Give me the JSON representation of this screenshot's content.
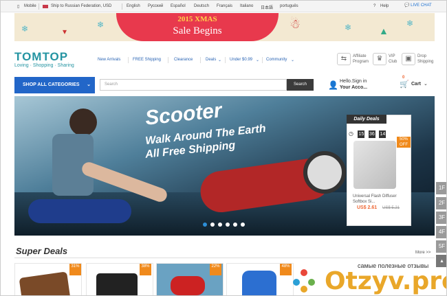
{
  "topbar": {
    "mobile": "Mobile",
    "ship_to": "Ship to Russian Federation, USD",
    "languages": [
      "English",
      "Русский",
      "Español",
      "Deutsch",
      "Français",
      "Italiano",
      "日本語",
      "português"
    ],
    "help": "Help",
    "live_chat": "LIVE CHAT"
  },
  "banner": {
    "line1": "2015 XMAS",
    "line2": "Sale Begins"
  },
  "header": {
    "logo": "TOMTOP",
    "tagline": "Loving · Shopping · Sharing",
    "nav": [
      "New Arrivals",
      "FREE Shipping",
      "Clearance",
      "Deals",
      "Under $0.99",
      "Community"
    ],
    "affiliate": [
      "Affiliate",
      "Program"
    ],
    "vip": [
      "VIP",
      "Club"
    ],
    "drop": [
      "Drop",
      "Shipping"
    ]
  },
  "search": {
    "shop_all": "SHOP ALL CATEGORIES",
    "placeholder": "Search",
    "button": "Search",
    "hello": "Hello.Sign in",
    "account": "Your Acco...",
    "cart": "Cart",
    "cart_count": "0"
  },
  "hero": {
    "title": "Scooter",
    "line2": "Walk Around The Earth",
    "line3": "All Free Shipping"
  },
  "daily_deal": {
    "label": "Daily Deals",
    "timer": [
      "15",
      "36",
      "14"
    ],
    "badge": "50% OFF",
    "product": "Universal Flash Diffuser Softbox Si...",
    "price": "US$ 2.61",
    "old_price": "US$ 5.21"
  },
  "floors": [
    "1F",
    "2F",
    "3F",
    "4F",
    "5F"
  ],
  "super_deals": {
    "title": "Super Deals",
    "more": "More >>",
    "badges": [
      "31%",
      "38%",
      "22%",
      "48%"
    ]
  },
  "watermark": {
    "text": "самые полезные отзывы",
    "brand": "Otzyv.pro"
  }
}
